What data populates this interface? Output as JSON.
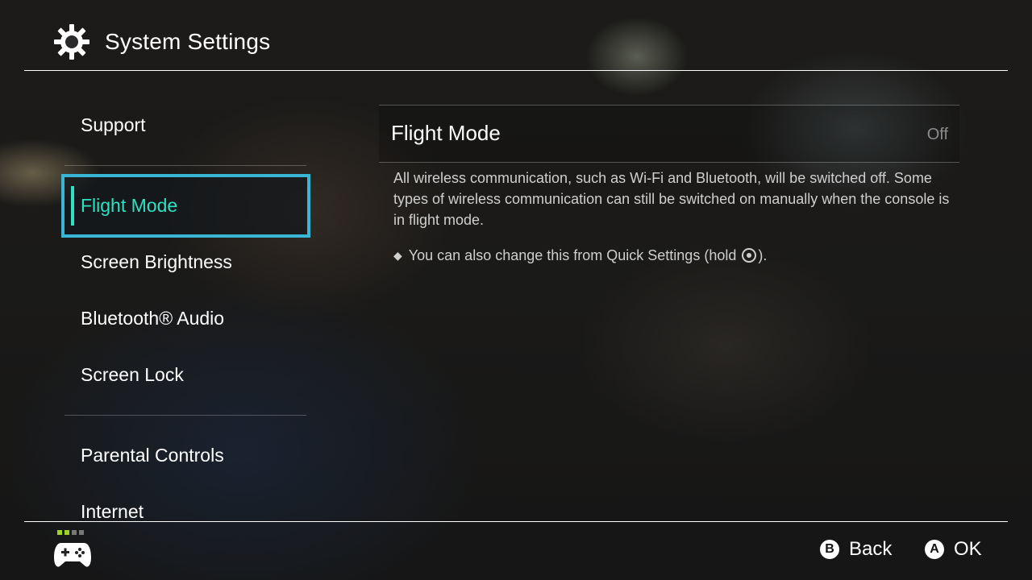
{
  "header": {
    "title": "System Settings",
    "icon": "gear-icon"
  },
  "sidebar": {
    "items": [
      {
        "label": "Support"
      },
      {
        "label": "Flight Mode",
        "selected": true
      },
      {
        "label": "Screen Brightness"
      },
      {
        "label": "Bluetooth® Audio"
      },
      {
        "label": "Screen Lock"
      },
      {
        "label": "Parental Controls"
      },
      {
        "label": "Internet"
      }
    ]
  },
  "detail": {
    "title": "Flight Mode",
    "value": "Off",
    "description": "All wireless communication, such as Wi-Fi and Bluetooth, will be switched off. Some types of wireless communication can still be switched on manually when the console is in flight mode.",
    "hint_prefix": "You can also change this from Quick Settings (hold",
    "hint_suffix": ")."
  },
  "footer": {
    "back": {
      "button": "B",
      "label": "Back"
    },
    "ok": {
      "button": "A",
      "label": "OK"
    },
    "controller_icon": "controller-icon",
    "indicator_colors": [
      "#9ed321",
      "#9ed321",
      "#777777",
      "#777777"
    ]
  },
  "colors": {
    "selection_border": "#39b6d6",
    "selection_text": "#2de2c3",
    "divider": "#ffffff"
  }
}
